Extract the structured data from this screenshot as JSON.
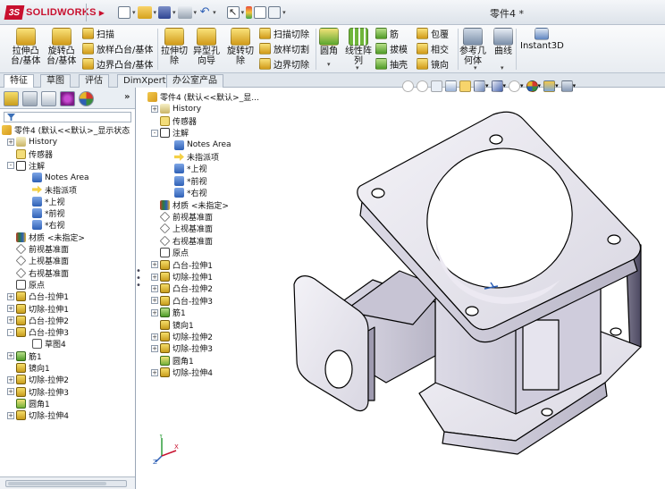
{
  "app": {
    "brand_mark": "3S",
    "brand_name": "SOLIDWORKS",
    "window_title": "零件4 *"
  },
  "ribbon": {
    "big_buttons": [
      {
        "label": "拉伸凸\n台/基体",
        "icon": "extrude-boss-icon"
      },
      {
        "label": "旋转凸\n台/基体",
        "icon": "revolve-boss-icon"
      },
      {
        "label": "拉伸切\n除",
        "icon": "extrude-cut-icon"
      },
      {
        "label": "异型孔\n向导",
        "icon": "hole-wizard-icon"
      },
      {
        "label": "旋转切\n除",
        "icon": "revolve-cut-icon"
      },
      {
        "label": "圆角",
        "icon": "fillet-icon"
      },
      {
        "label": "线性阵\n列",
        "icon": "linear-pattern-icon"
      },
      {
        "label": "参考几\n何体",
        "icon": "reference-geometry-icon"
      },
      {
        "label": "曲线",
        "icon": "curves-icon"
      },
      {
        "label": "Instant3D",
        "icon": "instant3d-icon"
      }
    ],
    "small_buttons": [
      {
        "label": "扫描",
        "icon": "sweep-icon"
      },
      {
        "label": "放样凸台/基体",
        "icon": "loft-icon"
      },
      {
        "label": "边界凸台/基体",
        "icon": "boundary-boss-icon"
      },
      {
        "label": "扫描切除",
        "icon": "swept-cut-icon"
      },
      {
        "label": "放样切割",
        "icon": "lofted-cut-icon"
      },
      {
        "label": "边界切除",
        "icon": "boundary-cut-icon"
      },
      {
        "label": "筋",
        "icon": "rib-icon"
      },
      {
        "label": "拔模",
        "icon": "draft-icon"
      },
      {
        "label": "抽壳",
        "icon": "shell-icon"
      },
      {
        "label": "包覆",
        "icon": "wrap-icon"
      },
      {
        "label": "相交",
        "icon": "intersect-icon"
      },
      {
        "label": "镜向",
        "icon": "mirror-icon"
      }
    ]
  },
  "tabs": [
    "特征",
    "草图",
    "评估",
    "DimXpert",
    "办公室产品"
  ],
  "feature_tree": {
    "root": "零件4 (默认<<默认>_显示状态",
    "items": [
      {
        "label": "History",
        "icon": "history-icon",
        "expand": "+",
        "level": 1
      },
      {
        "label": "传感器",
        "icon": "sensor-icon",
        "expand": "",
        "level": 1
      },
      {
        "label": "注解",
        "icon": "annotations-icon",
        "expand": "-",
        "level": 1
      },
      {
        "label": "Notes Area",
        "icon": "notes-area-icon",
        "expand": "",
        "level": 2
      },
      {
        "label": "未指派项",
        "icon": "unassigned-icon",
        "expand": "",
        "level": 2
      },
      {
        "label": "*上视",
        "icon": "view-icon",
        "expand": "",
        "level": 2
      },
      {
        "label": "*前视",
        "icon": "view-icon",
        "expand": "",
        "level": 2
      },
      {
        "label": "*右视",
        "icon": "view-icon",
        "expand": "",
        "level": 2
      },
      {
        "label": "材质 <未指定>",
        "icon": "material-icon",
        "expand": "",
        "level": 1
      },
      {
        "label": "前视基准面",
        "icon": "plane-icon",
        "expand": "",
        "level": 1
      },
      {
        "label": "上视基准面",
        "icon": "plane-icon",
        "expand": "",
        "level": 1
      },
      {
        "label": "右视基准面",
        "icon": "plane-icon",
        "expand": "",
        "level": 1
      },
      {
        "label": "原点",
        "icon": "origin-icon",
        "expand": "",
        "level": 1
      },
      {
        "label": "凸台-拉伸1",
        "icon": "boss-extrude-icon",
        "expand": "+",
        "level": 1
      },
      {
        "label": "切除-拉伸1",
        "icon": "cut-extrude-icon",
        "expand": "+",
        "level": 1
      },
      {
        "label": "凸台-拉伸2",
        "icon": "boss-extrude-icon",
        "expand": "+",
        "level": 1
      },
      {
        "label": "凸台-拉伸3",
        "icon": "boss-extrude-icon",
        "expand": "-",
        "level": 1
      },
      {
        "label": "草图4",
        "icon": "sketch-icon",
        "expand": "",
        "level": 2
      },
      {
        "label": "筋1",
        "icon": "rib-icon",
        "expand": "+",
        "level": 1
      },
      {
        "label": "镜向1",
        "icon": "mirror-icon",
        "expand": "",
        "level": 1
      },
      {
        "label": "切除-拉伸2",
        "icon": "cut-extrude-icon",
        "expand": "+",
        "level": 1
      },
      {
        "label": "切除-拉伸3",
        "icon": "cut-extrude-icon",
        "expand": "+",
        "level": 1
      },
      {
        "label": "圆角1",
        "icon": "fillet-icon",
        "expand": "",
        "level": 1
      },
      {
        "label": "切除-拉伸4",
        "icon": "cut-extrude-icon",
        "expand": "+",
        "level": 1
      }
    ]
  },
  "flyout_tree": {
    "root": "零件4 (默认<<默认>_显...",
    "items": [
      {
        "label": "History",
        "icon": "history-icon",
        "expand": "+",
        "level": 1
      },
      {
        "label": "传感器",
        "icon": "sensor-icon",
        "expand": "",
        "level": 1
      },
      {
        "label": "注解",
        "icon": "annotations-icon",
        "expand": "-",
        "level": 1
      },
      {
        "label": "Notes Area",
        "icon": "notes-area-icon",
        "expand": "",
        "level": 2
      },
      {
        "label": "未指派项",
        "icon": "unassigned-icon",
        "expand": "",
        "level": 2
      },
      {
        "label": "*上视",
        "icon": "view-icon",
        "expand": "",
        "level": 2
      },
      {
        "label": "*前视",
        "icon": "view-icon",
        "expand": "",
        "level": 2
      },
      {
        "label": "*右视",
        "icon": "view-icon",
        "expand": "",
        "level": 2
      },
      {
        "label": "材质 <未指定>",
        "icon": "material-icon",
        "expand": "",
        "level": 1
      },
      {
        "label": "前视基准面",
        "icon": "plane-icon",
        "expand": "",
        "level": 1
      },
      {
        "label": "上视基准面",
        "icon": "plane-icon",
        "expand": "",
        "level": 1
      },
      {
        "label": "右视基准面",
        "icon": "plane-icon",
        "expand": "",
        "level": 1
      },
      {
        "label": "原点",
        "icon": "origin-icon",
        "expand": "",
        "level": 1
      },
      {
        "label": "凸台-拉伸1",
        "icon": "boss-extrude-icon",
        "expand": "+",
        "level": 1
      },
      {
        "label": "切除-拉伸1",
        "icon": "cut-extrude-icon",
        "expand": "+",
        "level": 1
      },
      {
        "label": "凸台-拉伸2",
        "icon": "boss-extrude-icon",
        "expand": "+",
        "level": 1
      },
      {
        "label": "凸台-拉伸3",
        "icon": "boss-extrude-icon",
        "expand": "+",
        "level": 1
      },
      {
        "label": "筋1",
        "icon": "rib-icon",
        "expand": "+",
        "level": 1
      },
      {
        "label": "镜向1",
        "icon": "mirror-icon",
        "expand": "",
        "level": 1
      },
      {
        "label": "切除-拉伸2",
        "icon": "cut-extrude-icon",
        "expand": "+",
        "level": 1
      },
      {
        "label": "切除-拉伸3",
        "icon": "cut-extrude-icon",
        "expand": "+",
        "level": 1
      },
      {
        "label": "圆角1",
        "icon": "fillet-icon",
        "expand": "",
        "level": 1
      },
      {
        "label": "切除-拉伸4",
        "icon": "cut-extrude-icon",
        "expand": "+",
        "level": 1
      }
    ]
  },
  "triad": {
    "x": "X",
    "y": "Y",
    "z": "Z"
  },
  "colors": {
    "brand": "#c8102e",
    "model_face": "#e4e2ec",
    "model_edge": "#000000",
    "accent_blue": "#2d5fb5"
  }
}
